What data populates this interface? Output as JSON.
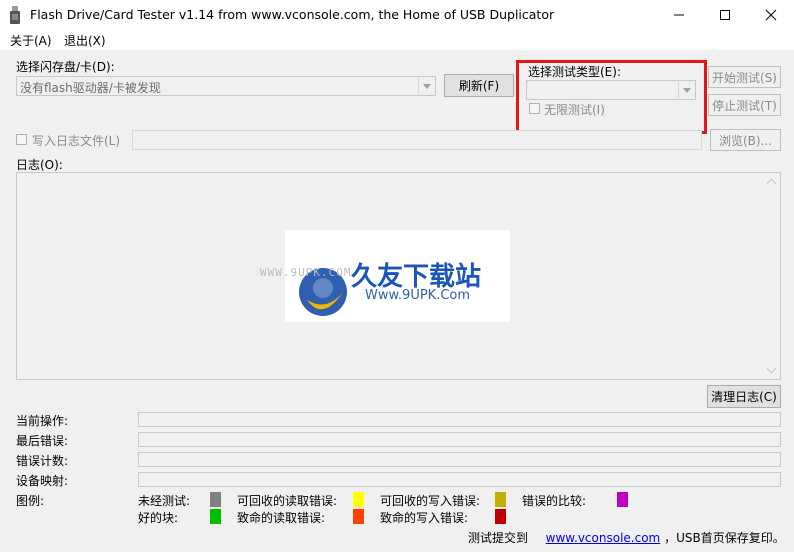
{
  "window": {
    "title": "Flash Drive/Card Tester v1.14 from www.vconsole.com, the Home of USB Duplicator"
  },
  "menu": {
    "about": "关于(A)",
    "exit": "退出(X)"
  },
  "drive": {
    "label": "选择闪存盘/卡(D):",
    "value": "没有flash驱动器/卡被发现",
    "refresh_label": "刷新(F)"
  },
  "test_type": {
    "label": "选择测试类型(E):",
    "value": "",
    "unlimited_label": "无限测试(I)"
  },
  "buttons": {
    "start": "开始测试(S)",
    "stop": "停止测试(T)",
    "browse": "浏览(B)...",
    "clear_log": "清理日志(C)"
  },
  "logfile": {
    "label": "写入日志文件(L)",
    "value": ""
  },
  "log": {
    "label": "日志(O):"
  },
  "watermark": {
    "site_small": "WWW.9UPK.COM",
    "brand": "久友下载站",
    "url": "Www.9UPK.Com"
  },
  "status": {
    "current_op": "当前操作:",
    "last_error": "最后错误:",
    "error_count": "错误计数:",
    "device_map": "设备映射:"
  },
  "legend": {
    "label": "图例:",
    "items": [
      {
        "label": "未经测试:",
        "color": "#808080"
      },
      {
        "label": "可回收的读取错误:",
        "color": "#ffff00"
      },
      {
        "label": "可回收的写入错误:",
        "color": "#c0b000"
      },
      {
        "label": "错误的比较:",
        "color": "#c000c0"
      },
      {
        "label": "好的块:",
        "color": "#00c000"
      },
      {
        "label": "致命的读取错误:",
        "color": "#ff4000"
      },
      {
        "label": "致命的写入错误:",
        "color": "#c00000"
      }
    ]
  },
  "footer": {
    "prefix": "测试提交到",
    "link": "www.vconsole.com",
    "suffix": "，USB首页保存复印。"
  },
  "colors": {
    "highlight": "#e31515",
    "background": "#f0f0f0"
  }
}
